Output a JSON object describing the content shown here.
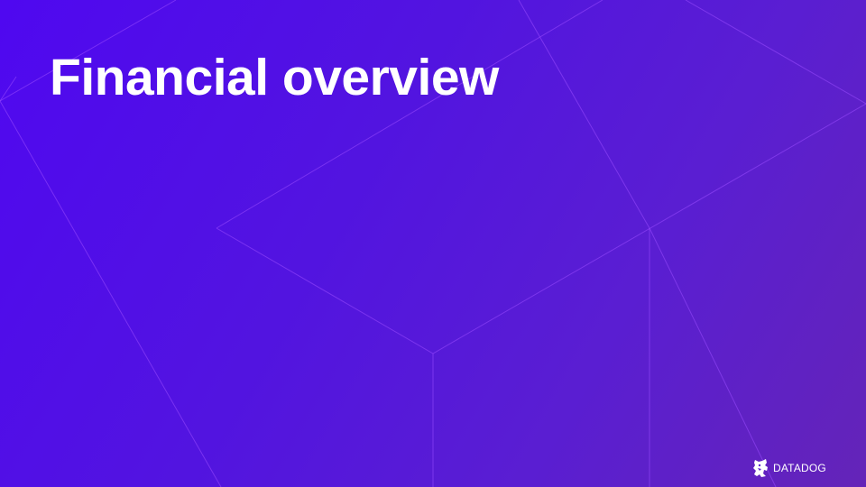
{
  "slide": {
    "title": "Financial overview",
    "background_start": "#4f08f0",
    "background_end": "#6424b8",
    "line_color": "#9a4dff"
  },
  "logo": {
    "text": "DATADOG",
    "icon": "datadog-dog-icon"
  }
}
